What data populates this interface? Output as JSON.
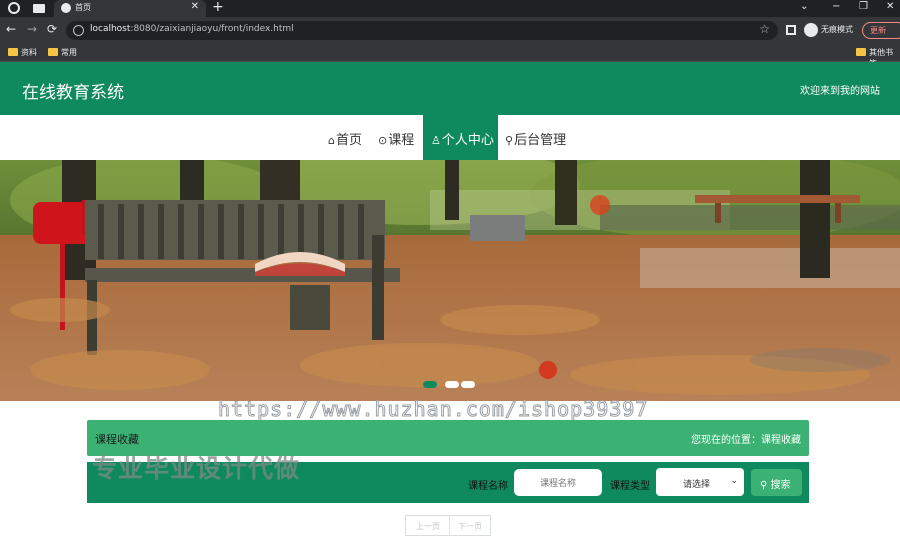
{
  "browser": {
    "tab_title": "首页",
    "tab_close": "✕",
    "new_tab": "+",
    "url_host": "localhost",
    "url_rest": ":8080/zaixianjiaoyu/front/index.html",
    "incognito_label": "无痕模式",
    "update_label": "更新",
    "bookmarks": [
      "资料",
      "常用",
      "其他书签"
    ],
    "nav": {
      "back": "←",
      "forward": "→",
      "reload": "⟳",
      "star": "☆"
    },
    "window": {
      "minimize": "−",
      "maximize": "❐",
      "close": "✕",
      "tab_search": "⌄"
    }
  },
  "header": {
    "site_title": "在线教育系统",
    "welcome": "欢迎来到我的网站"
  },
  "nav": {
    "items": [
      {
        "label": "首页",
        "icon": "⌂"
      },
      {
        "label": "课程",
        "icon": "⊙"
      },
      {
        "label": "个人中心",
        "icon": "♙"
      },
      {
        "label": "后台管理",
        "icon": "⚲"
      }
    ],
    "active": "个人中心"
  },
  "banner": {
    "slides": 3,
    "active_slide": 1
  },
  "watermarks": {
    "url": "https://www.huzhan.com/ishop39397",
    "big": "专业毕业设计代做"
  },
  "breadcrumb": {
    "title": "课程收藏",
    "position": "您现在的位置：课程收藏"
  },
  "search": {
    "name_label": "课程名称",
    "name_placeholder": "课程名称",
    "type_label": "课程类型",
    "type_value": "请选择",
    "button": "搜索"
  },
  "pager": {
    "prev": "上一页",
    "next": "下一页"
  },
  "colors": {
    "primary": "#0f8a5f",
    "secondary": "#3bb273"
  }
}
